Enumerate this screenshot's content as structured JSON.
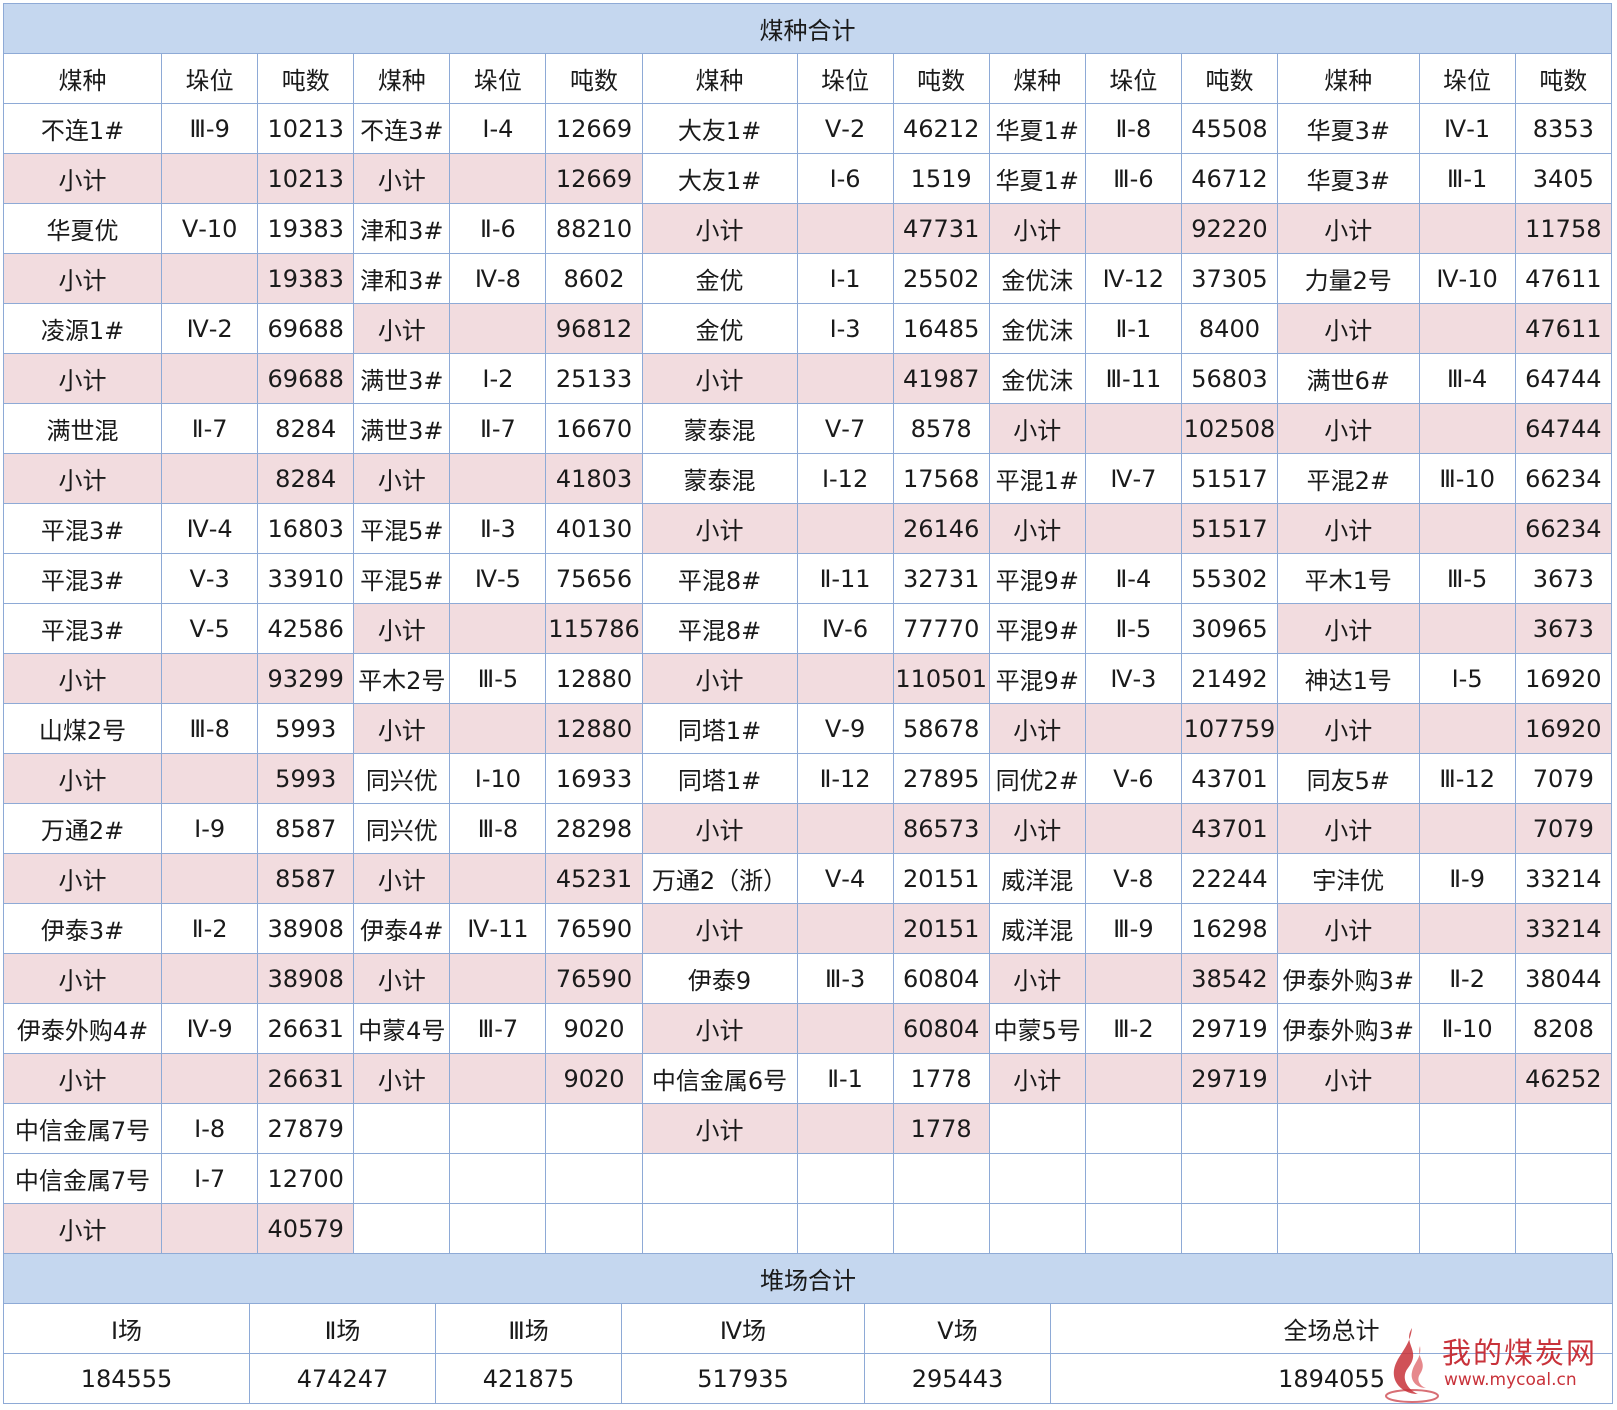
{
  "coal_section": {
    "title": "煤种合计",
    "headers": [
      "煤种",
      "垛位",
      "吨数",
      "煤种",
      "垛位",
      "吨数",
      "煤种",
      "垛位",
      "吨数",
      "煤种",
      "垛位",
      "吨数",
      "煤种",
      "垛位",
      "吨数"
    ],
    "rows": [
      [
        [
          "不连1#",
          "Ⅲ-9",
          "10213"
        ],
        [
          "不连3#",
          "Ⅰ-4",
          "12669"
        ],
        [
          "大友1#",
          "Ⅴ-2",
          "46212"
        ],
        [
          "华夏1#",
          "Ⅱ-8",
          "45508"
        ],
        [
          "华夏3#",
          "Ⅳ-1",
          "8353"
        ]
      ],
      [
        [
          "小计",
          "",
          "10213"
        ],
        [
          "小计",
          "",
          "12669"
        ],
        [
          "大友1#",
          "Ⅰ-6",
          "1519"
        ],
        [
          "华夏1#",
          "Ⅲ-6",
          "46712"
        ],
        [
          "华夏3#",
          "Ⅲ-1",
          "3405"
        ]
      ],
      [
        [
          "华夏优",
          "Ⅴ-10",
          "19383"
        ],
        [
          "津和3#",
          "Ⅱ-6",
          "88210"
        ],
        [
          "小计",
          "",
          "47731"
        ],
        [
          "小计",
          "",
          "92220"
        ],
        [
          "小计",
          "",
          "11758"
        ]
      ],
      [
        [
          "小计",
          "",
          "19383"
        ],
        [
          "津和3#",
          "Ⅳ-8",
          "8602"
        ],
        [
          "金优",
          "Ⅰ-1",
          "25502"
        ],
        [
          "金优沫",
          "Ⅳ-12",
          "37305"
        ],
        [
          "力量2号",
          "Ⅳ-10",
          "47611"
        ]
      ],
      [
        [
          "凌源1#",
          "Ⅳ-2",
          "69688"
        ],
        [
          "小计",
          "",
          "96812"
        ],
        [
          "金优",
          "Ⅰ-3",
          "16485"
        ],
        [
          "金优沫",
          "Ⅱ-1",
          "8400"
        ],
        [
          "小计",
          "",
          "47611"
        ]
      ],
      [
        [
          "小计",
          "",
          "69688"
        ],
        [
          "满世3#",
          "Ⅰ-2",
          "25133"
        ],
        [
          "小计",
          "",
          "41987"
        ],
        [
          "金优沫",
          "Ⅲ-11",
          "56803"
        ],
        [
          "满世6#",
          "Ⅲ-4",
          "64744"
        ]
      ],
      [
        [
          "满世混",
          "Ⅱ-7",
          "8284"
        ],
        [
          "满世3#",
          "Ⅱ-7",
          "16670"
        ],
        [
          "蒙泰混",
          "Ⅴ-7",
          "8578"
        ],
        [
          "小计",
          "",
          "102508"
        ],
        [
          "小计",
          "",
          "64744"
        ]
      ],
      [
        [
          "小计",
          "",
          "8284"
        ],
        [
          "小计",
          "",
          "41803"
        ],
        [
          "蒙泰混",
          "Ⅰ-12",
          "17568"
        ],
        [
          "平混1#",
          "Ⅳ-7",
          "51517"
        ],
        [
          "平混2#",
          "Ⅲ-10",
          "66234"
        ]
      ],
      [
        [
          "平混3#",
          "Ⅳ-4",
          "16803"
        ],
        [
          "平混5#",
          "Ⅱ-3",
          "40130"
        ],
        [
          "小计",
          "",
          "26146"
        ],
        [
          "小计",
          "",
          "51517"
        ],
        [
          "小计",
          "",
          "66234"
        ]
      ],
      [
        [
          "平混3#",
          "Ⅴ-3",
          "33910"
        ],
        [
          "平混5#",
          "Ⅳ-5",
          "75656"
        ],
        [
          "平混8#",
          "Ⅱ-11",
          "32731"
        ],
        [
          "平混9#",
          "Ⅱ-4",
          "55302"
        ],
        [
          "平木1号",
          "Ⅲ-5",
          "3673"
        ]
      ],
      [
        [
          "平混3#",
          "Ⅴ-5",
          "42586"
        ],
        [
          "小计",
          "",
          "115786"
        ],
        [
          "平混8#",
          "Ⅳ-6",
          "77770"
        ],
        [
          "平混9#",
          "Ⅱ-5",
          "30965"
        ],
        [
          "小计",
          "",
          "3673"
        ]
      ],
      [
        [
          "小计",
          "",
          "93299"
        ],
        [
          "平木2号",
          "Ⅲ-5",
          "12880"
        ],
        [
          "小计",
          "",
          "110501"
        ],
        [
          "平混9#",
          "Ⅳ-3",
          "21492"
        ],
        [
          "神达1号",
          "Ⅰ-5",
          "16920"
        ]
      ],
      [
        [
          "山煤2号",
          "Ⅲ-8",
          "5993"
        ],
        [
          "小计",
          "",
          "12880"
        ],
        [
          "同塔1#",
          "Ⅴ-9",
          "58678"
        ],
        [
          "小计",
          "",
          "107759"
        ],
        [
          "小计",
          "",
          "16920"
        ]
      ],
      [
        [
          "小计",
          "",
          "5993"
        ],
        [
          "同兴优",
          "Ⅰ-10",
          "16933"
        ],
        [
          "同塔1#",
          "Ⅱ-12",
          "27895"
        ],
        [
          "同优2#",
          "Ⅴ-6",
          "43701"
        ],
        [
          "同友5#",
          "Ⅲ-12",
          "7079"
        ]
      ],
      [
        [
          "万通2#",
          "Ⅰ-9",
          "8587"
        ],
        [
          "同兴优",
          "Ⅲ-8",
          "28298"
        ],
        [
          "小计",
          "",
          "86573"
        ],
        [
          "小计",
          "",
          "43701"
        ],
        [
          "小计",
          "",
          "7079"
        ]
      ],
      [
        [
          "小计",
          "",
          "8587"
        ],
        [
          "小计",
          "",
          "45231"
        ],
        [
          "万通2（浙）",
          "Ⅴ-4",
          "20151"
        ],
        [
          "威洋混",
          "Ⅴ-8",
          "22244"
        ],
        [
          "宇沣优",
          "Ⅱ-9",
          "33214"
        ]
      ],
      [
        [
          "伊泰3#",
          "Ⅱ-2",
          "38908"
        ],
        [
          "伊泰4#",
          "Ⅳ-11",
          "76590"
        ],
        [
          "小计",
          "",
          "20151"
        ],
        [
          "威洋混",
          "Ⅲ-9",
          "16298"
        ],
        [
          "小计",
          "",
          "33214"
        ]
      ],
      [
        [
          "小计",
          "",
          "38908"
        ],
        [
          "小计",
          "",
          "76590"
        ],
        [
          "伊泰9",
          "Ⅲ-3",
          "60804"
        ],
        [
          "小计",
          "",
          "38542"
        ],
        [
          "伊泰外购3#",
          "Ⅱ-2",
          "38044"
        ]
      ],
      [
        [
          "伊泰外购4#",
          "Ⅳ-9",
          "26631"
        ],
        [
          "中蒙4号",
          "Ⅲ-7",
          "9020"
        ],
        [
          "小计",
          "",
          "60804"
        ],
        [
          "中蒙5号",
          "Ⅲ-2",
          "29719"
        ],
        [
          "伊泰外购3#",
          "Ⅱ-10",
          "8208"
        ]
      ],
      [
        [
          "小计",
          "",
          "26631"
        ],
        [
          "小计",
          "",
          "9020"
        ],
        [
          "中信金属6号",
          "Ⅱ-1",
          "1778"
        ],
        [
          "小计",
          "",
          "29719"
        ],
        [
          "小计",
          "",
          "46252"
        ]
      ],
      [
        [
          "中信金属7号",
          "Ⅰ-8",
          "27879"
        ],
        [
          "",
          "",
          ""
        ],
        [
          "小计",
          "",
          "1778"
        ],
        [
          "",
          "",
          ""
        ],
        [
          "",
          "",
          ""
        ]
      ],
      [
        [
          "中信金属7号",
          "Ⅰ-7",
          "12700"
        ],
        [
          "",
          "",
          ""
        ],
        [
          "",
          "",
          ""
        ],
        [
          "",
          "",
          ""
        ],
        [
          "",
          "",
          ""
        ]
      ],
      [
        [
          "小计",
          "",
          "40579"
        ],
        [
          "",
          "",
          ""
        ],
        [
          "",
          "",
          ""
        ],
        [
          "",
          "",
          ""
        ],
        [
          "",
          "",
          ""
        ]
      ]
    ]
  },
  "yard_section": {
    "title": "堆场合计",
    "headers": [
      "Ⅰ场",
      "Ⅱ场",
      "Ⅲ场",
      "Ⅳ场",
      "Ⅴ场",
      "全场总计"
    ],
    "values": [
      "184555",
      "474247",
      "421875",
      "517935",
      "295443",
      "1894055"
    ]
  },
  "watermark": {
    "brand": "我的煤炭网",
    "url": "www.mycoal.cn"
  },
  "colors": {
    "header_band": "#c5d7ef",
    "subtotal_fill": "#f2dcdf",
    "grid_line": "#8eaad6",
    "watermark": "#c8323a"
  }
}
